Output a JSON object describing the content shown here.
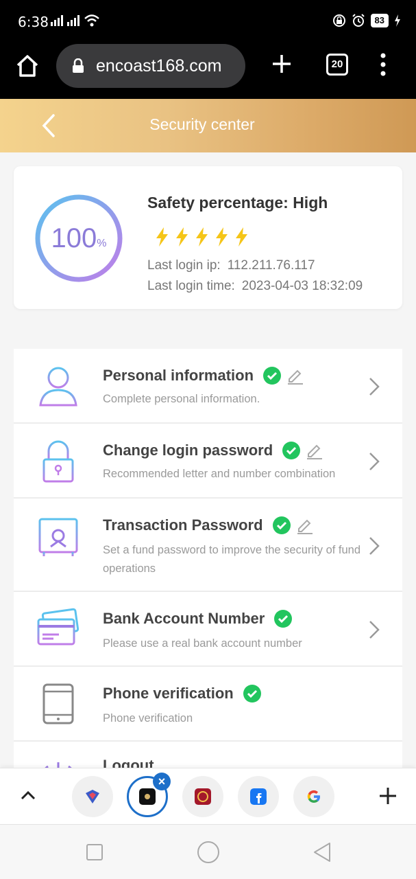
{
  "status_bar": {
    "time": "6:38",
    "battery": "83"
  },
  "browser": {
    "url": "encoast168.com",
    "tab_count": "20"
  },
  "header": {
    "title": "Security center"
  },
  "safety": {
    "percent": "100",
    "percent_sign": "%",
    "title": "Safety percentage: High",
    "level": 5,
    "last_ip_label": "Last login ip:",
    "last_ip": "112.211.76.117",
    "last_time_label": "Last login time:",
    "last_time": "2023-04-03 18:32:09"
  },
  "items": [
    {
      "title": "Personal information",
      "desc": "Complete personal information."
    },
    {
      "title": "Change login password",
      "desc": "Recommended letter and number combination"
    },
    {
      "title": "Transaction Password",
      "desc": "Set a fund password to improve the security of fund operations"
    },
    {
      "title": "Bank Account Number",
      "desc": "Please use a real bank account number"
    },
    {
      "title": "Phone verification",
      "desc": "Phone verification"
    },
    {
      "title": "Logout"
    }
  ],
  "colors": {
    "accent_gold": "#dcaa68",
    "check_green": "#22c55e",
    "tab_active": "#1d6fc9",
    "icon_purple": "#b07ae6",
    "icon_blue": "#5bc2ee"
  }
}
